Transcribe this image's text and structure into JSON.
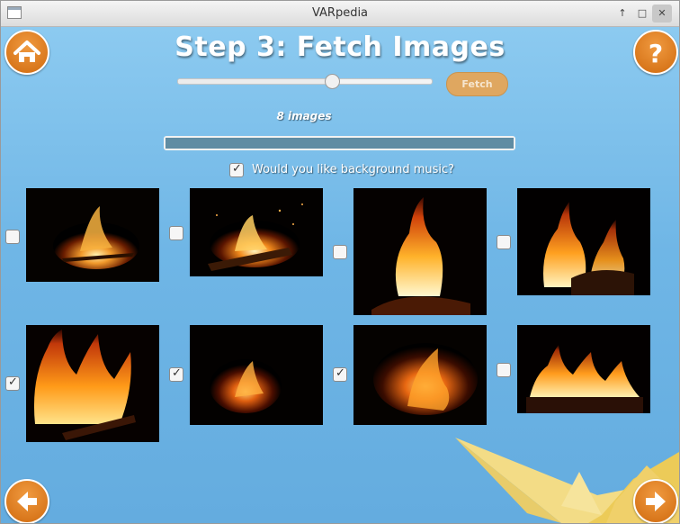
{
  "window": {
    "title": "VARpedia"
  },
  "header": {
    "title": "Step 3: Fetch Images"
  },
  "slider": {
    "value": 8,
    "min": 1,
    "max": 10
  },
  "fetch_button": {
    "label": "Fetch"
  },
  "image_count": {
    "label": "8 images"
  },
  "progress": {
    "fraction": 1.0
  },
  "music_checkbox": {
    "label": "Would you like background music?",
    "checked": true
  },
  "images": [
    {
      "checked": false,
      "icon": "bonfire-image"
    },
    {
      "checked": false,
      "icon": "campfire-logs-image"
    },
    {
      "checked": false,
      "icon": "fire-flames-image"
    },
    {
      "checked": false,
      "icon": "fire-flames-image"
    },
    {
      "checked": true,
      "icon": "fire-flames-image"
    },
    {
      "checked": true,
      "icon": "embers-image"
    },
    {
      "checked": true,
      "icon": "fire-flames-image"
    },
    {
      "checked": false,
      "icon": "log-fire-image"
    }
  ],
  "colors": {
    "accent": "#e07b1a",
    "background": "#7ec2ec"
  }
}
